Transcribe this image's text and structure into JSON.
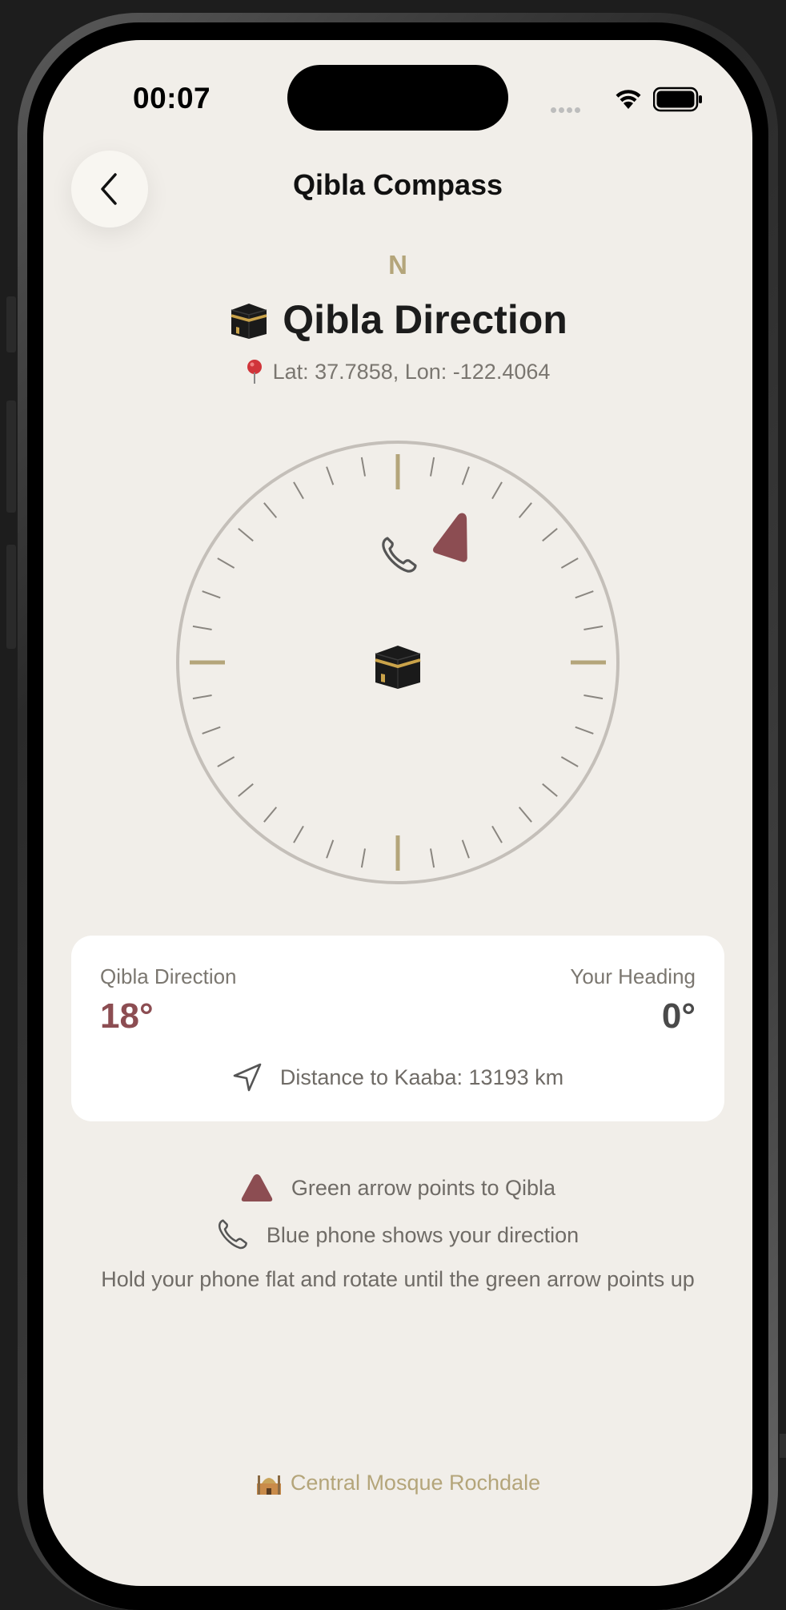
{
  "status_bar": {
    "time": "00:07"
  },
  "nav": {
    "title": "Qibla Compass",
    "back_icon": "chevron-left-icon"
  },
  "compass": {
    "north_label": "N",
    "qibla_bearing_deg": 18,
    "device_heading_deg": 0,
    "center_icon": "kaaba-icon",
    "qibla_marker_color": "#8c4d52",
    "phone_marker_icon": "phone-icon",
    "cardinal_tick_color": "#b4a57a"
  },
  "header": {
    "title": "Qibla Direction",
    "icon": "kaaba-icon",
    "coords_icon": "pin-icon",
    "coords": "Lat: 37.7858, Lon: -122.4064"
  },
  "card": {
    "qibla_label": "Qibla Direction",
    "qibla_value": "18°",
    "heading_label": "Your Heading",
    "heading_value": "0°",
    "distance_icon": "navigation-arrow-icon",
    "distance_text": "Distance to Kaaba: 13193 km"
  },
  "legend": {
    "arrow_text": "Green arrow points to Qibla",
    "phone_text": "Blue phone shows your direction",
    "instruction": "Hold your phone flat and rotate until the green arrow points up"
  },
  "footer": {
    "icon": "mosque-icon",
    "text": "Central Mosque Rochdale"
  },
  "colors": {
    "background": "#f1eee9",
    "accent": "#8c4d52",
    "gold": "#b4a57a"
  }
}
